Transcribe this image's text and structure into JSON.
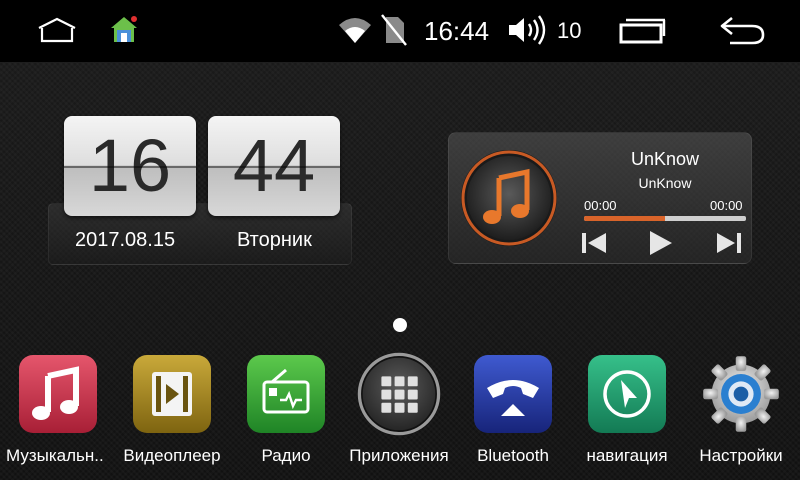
{
  "status_bar": {
    "time": "16:44",
    "volume_level": "10",
    "icons": [
      "home-icon",
      "house-app-icon",
      "wifi-icon",
      "no-sim-icon",
      "volume-icon",
      "recent-apps-icon",
      "back-icon"
    ]
  },
  "clock_widget": {
    "hour": "16",
    "minute": "44",
    "date": "2017.08.15",
    "weekday": "Вторник"
  },
  "music_widget": {
    "title": "UnKnow",
    "artist": "UnKnow",
    "current_time": "00:00",
    "total_time": "00:00",
    "progress_fraction": 0.5,
    "accent_color": "#d9642a",
    "controls": [
      "previous-icon",
      "play-icon",
      "next-icon"
    ]
  },
  "dock": {
    "apps": [
      {
        "label": "Музыкальн..",
        "icon": "music-note-icon",
        "color": "#c8304a"
      },
      {
        "label": "Видеоплеер",
        "icon": "film-icon",
        "color": "#a88a1a"
      },
      {
        "label": "Радио",
        "icon": "radio-icon",
        "color": "#3aa63a"
      },
      {
        "label": "Приложения",
        "icon": "app-grid-icon",
        "color": "#555555"
      },
      {
        "label": "Bluetooth",
        "icon": "phone-icon",
        "color": "#2a3fa0"
      },
      {
        "label": "навигация",
        "icon": "navigation-icon",
        "color": "#1d9a6a"
      },
      {
        "label": "Настройки",
        "icon": "gear-icon",
        "color": "#2a7fd0"
      }
    ]
  }
}
